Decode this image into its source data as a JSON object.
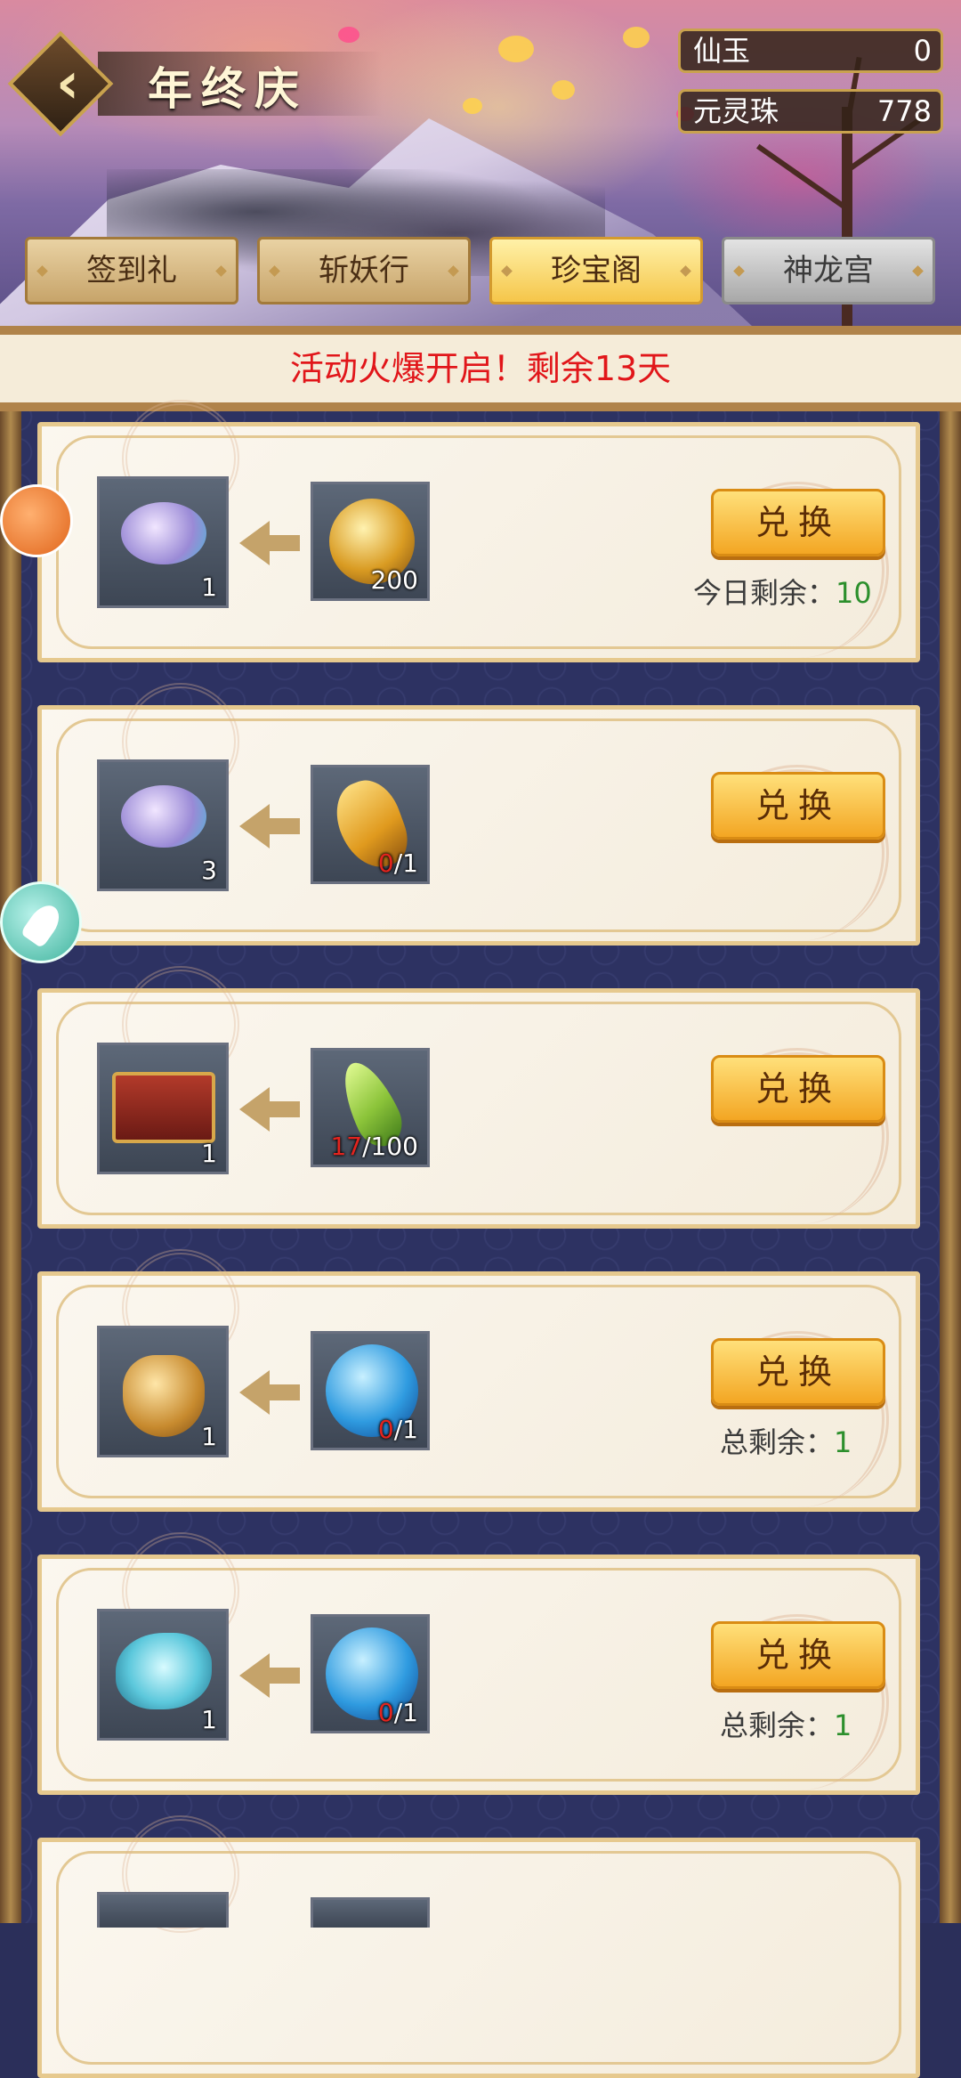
{
  "header": {
    "title": "年终庆",
    "currencies": [
      {
        "label": "仙玉",
        "value": "0"
      },
      {
        "label": "元灵珠",
        "value": "778"
      }
    ]
  },
  "tabs": [
    {
      "label": "签到礼",
      "state": "normal"
    },
    {
      "label": "斩妖行",
      "state": "normal"
    },
    {
      "label": "珍宝阁",
      "state": "active"
    },
    {
      "label": "神龙宫",
      "state": "disabled"
    }
  ],
  "notice": "活动火爆开启！剩余13天",
  "exchange_items": [
    {
      "reward_icon": "cloud-jade-icon",
      "reward_count": "1",
      "cost_icon": "golden-orb-icon",
      "cost_have": "",
      "cost_text": "200",
      "button": "兑换",
      "remain_label": "今日剩余：",
      "remain_value": "10"
    },
    {
      "reward_icon": "cloud-jade-icon",
      "reward_count": "3",
      "cost_icon": "golden-fish-icon",
      "cost_have": "0",
      "cost_text": "/1",
      "button": "兑换",
      "remain_label": "",
      "remain_value": ""
    },
    {
      "reward_icon": "treasure-chest-icon",
      "reward_count": "1",
      "cost_icon": "green-leaf-icon",
      "cost_have": "17",
      "cost_text": "/100",
      "button": "兑换",
      "remain_label": "",
      "remain_value": ""
    },
    {
      "reward_icon": "golden-token-icon",
      "reward_count": "1",
      "cost_icon": "blue-beast-orb-icon",
      "cost_have": "0",
      "cost_text": "/1",
      "button": "兑换",
      "remain_label": "总剩余：",
      "remain_value": "1"
    },
    {
      "reward_icon": "spirit-fish-icon",
      "reward_count": "1",
      "cost_icon": "blue-beast-orb-icon",
      "cost_have": "0",
      "cost_text": "/1",
      "button": "兑换",
      "remain_label": "总剩余：",
      "remain_value": "1"
    }
  ],
  "colors": {
    "notice": "#e1161a",
    "remain_number": "#2c8f2c",
    "button": "#f3a623"
  }
}
